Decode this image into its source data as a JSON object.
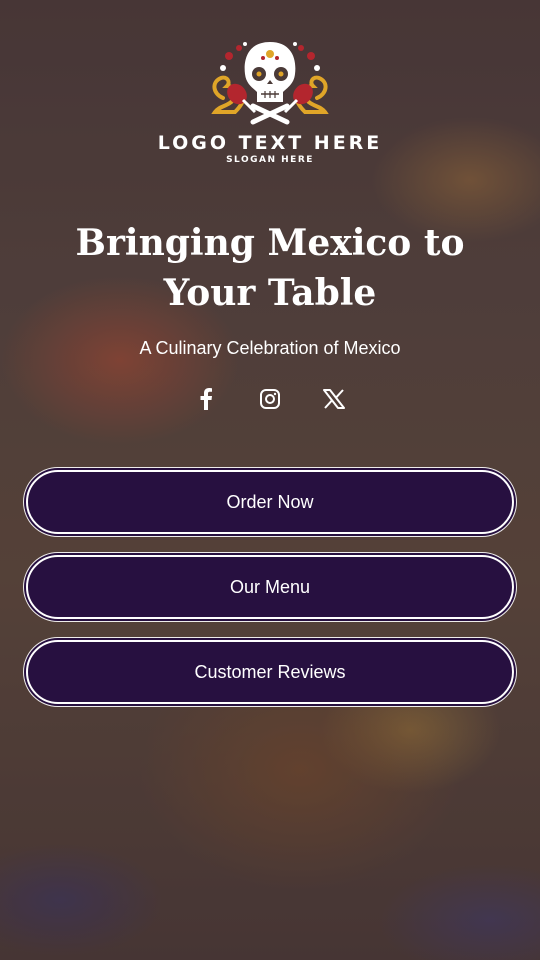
{
  "brand": {
    "logo_text": "LOGO TEXT HERE",
    "slogan": "SLOGAN HERE",
    "logo_icon": "sugar-skull-icon"
  },
  "hero": {
    "headline": "Bringing Mexico to Your Table",
    "tagline": "A Culinary Celebration of Mexico"
  },
  "social": [
    {
      "icon": "facebook-icon"
    },
    {
      "icon": "instagram-icon"
    },
    {
      "icon": "x-icon"
    }
  ],
  "buttons": {
    "order_now": "Order Now",
    "our_menu": "Our Menu",
    "customer_reviews": "Customer Reviews"
  },
  "colors": {
    "button_fill": "#271040",
    "text": "#ffffff",
    "logo_gold": "#e0a528",
    "logo_red": "#b3262e"
  }
}
